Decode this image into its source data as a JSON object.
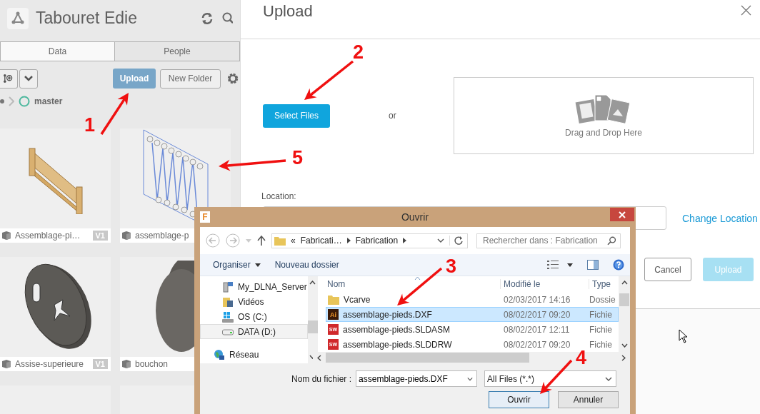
{
  "app": {
    "title": "Tabouret Edie"
  },
  "tabs": [
    {
      "label": "Data",
      "selected": true
    },
    {
      "label": "People",
      "selected": false
    }
  ],
  "toolbar": {
    "upload_button": "Upload",
    "new_folder_button": "New Folder"
  },
  "breadcrumb": {
    "branch": "master"
  },
  "items": [
    {
      "name": "Assemblage-pi…",
      "version": "V1",
      "kind": "frame"
    },
    {
      "name": "assemblage-p",
      "kind": "sketch"
    },
    {
      "name": "Assise-superieure",
      "version": "V1",
      "kind": "disc"
    },
    {
      "name": "bouchon",
      "kind": "cap"
    }
  ],
  "upload_dialog": {
    "title": "Upload",
    "select_button": "Select Files",
    "or_text": "or",
    "drop_zone": "Drag and Drop Here",
    "location_label": "Location:",
    "change_location_link": "Change Location",
    "cancel_button": "Cancel",
    "upload_button": {
      "label": "Upload",
      "disabled": true
    }
  },
  "file_dialog": {
    "app_icon": "F",
    "title": "Ouvrir",
    "path": [
      "«",
      "Fabricati…",
      "Fabrication"
    ],
    "search": {
      "placeholder": "Rechercher dans : Fabrication"
    },
    "organize_menu": "Organiser",
    "new_folder_button": "Nouveau dossier",
    "nav_items": [
      {
        "label": "My_DLNA_Server",
        "kind": "server",
        "selected": false
      },
      {
        "label": "Vidéos",
        "kind": "videos",
        "selected": false
      },
      {
        "label": "OS (C:)",
        "kind": "system-drive",
        "selected": false
      },
      {
        "label": "DATA (D:)",
        "kind": "drive",
        "selected": true
      },
      {
        "label": "Réseau",
        "kind": "network",
        "selected": false
      }
    ],
    "columns": [
      "Nom",
      "Modifié le",
      "Type"
    ],
    "files": [
      {
        "name": "Vcarve",
        "modified": "02/03/2017 14:16",
        "type": "Dossie",
        "kind": "folder",
        "selected": false
      },
      {
        "name": "assemblage-pieds.DXF",
        "modified": "08/02/2017 09:20",
        "type": "Fichie",
        "kind": "dxf",
        "badge": "Ai",
        "selected": true
      },
      {
        "name": "assemblage-pieds.SLDASM",
        "modified": "08/02/2017 12:11",
        "type": "Fichie",
        "kind": "solidworks",
        "badge": "SW",
        "selected": false
      },
      {
        "name": "assemblage-pieds.SLDDRW",
        "modified": "08/02/2017 09:20",
        "type": "Fichie",
        "kind": "solidworks",
        "badge": "SW",
        "selected": false
      }
    ],
    "filename_label": "Nom du fichier :",
    "filename": "assemblage-pieds.DXF",
    "filter": "All Files (*.*)",
    "open_button": "Ouvrir",
    "cancel_button": "Annuler"
  },
  "annotations": [
    {
      "label": "1"
    },
    {
      "label": "2"
    },
    {
      "label": "3"
    },
    {
      "label": "4"
    },
    {
      "label": "5"
    }
  ]
}
